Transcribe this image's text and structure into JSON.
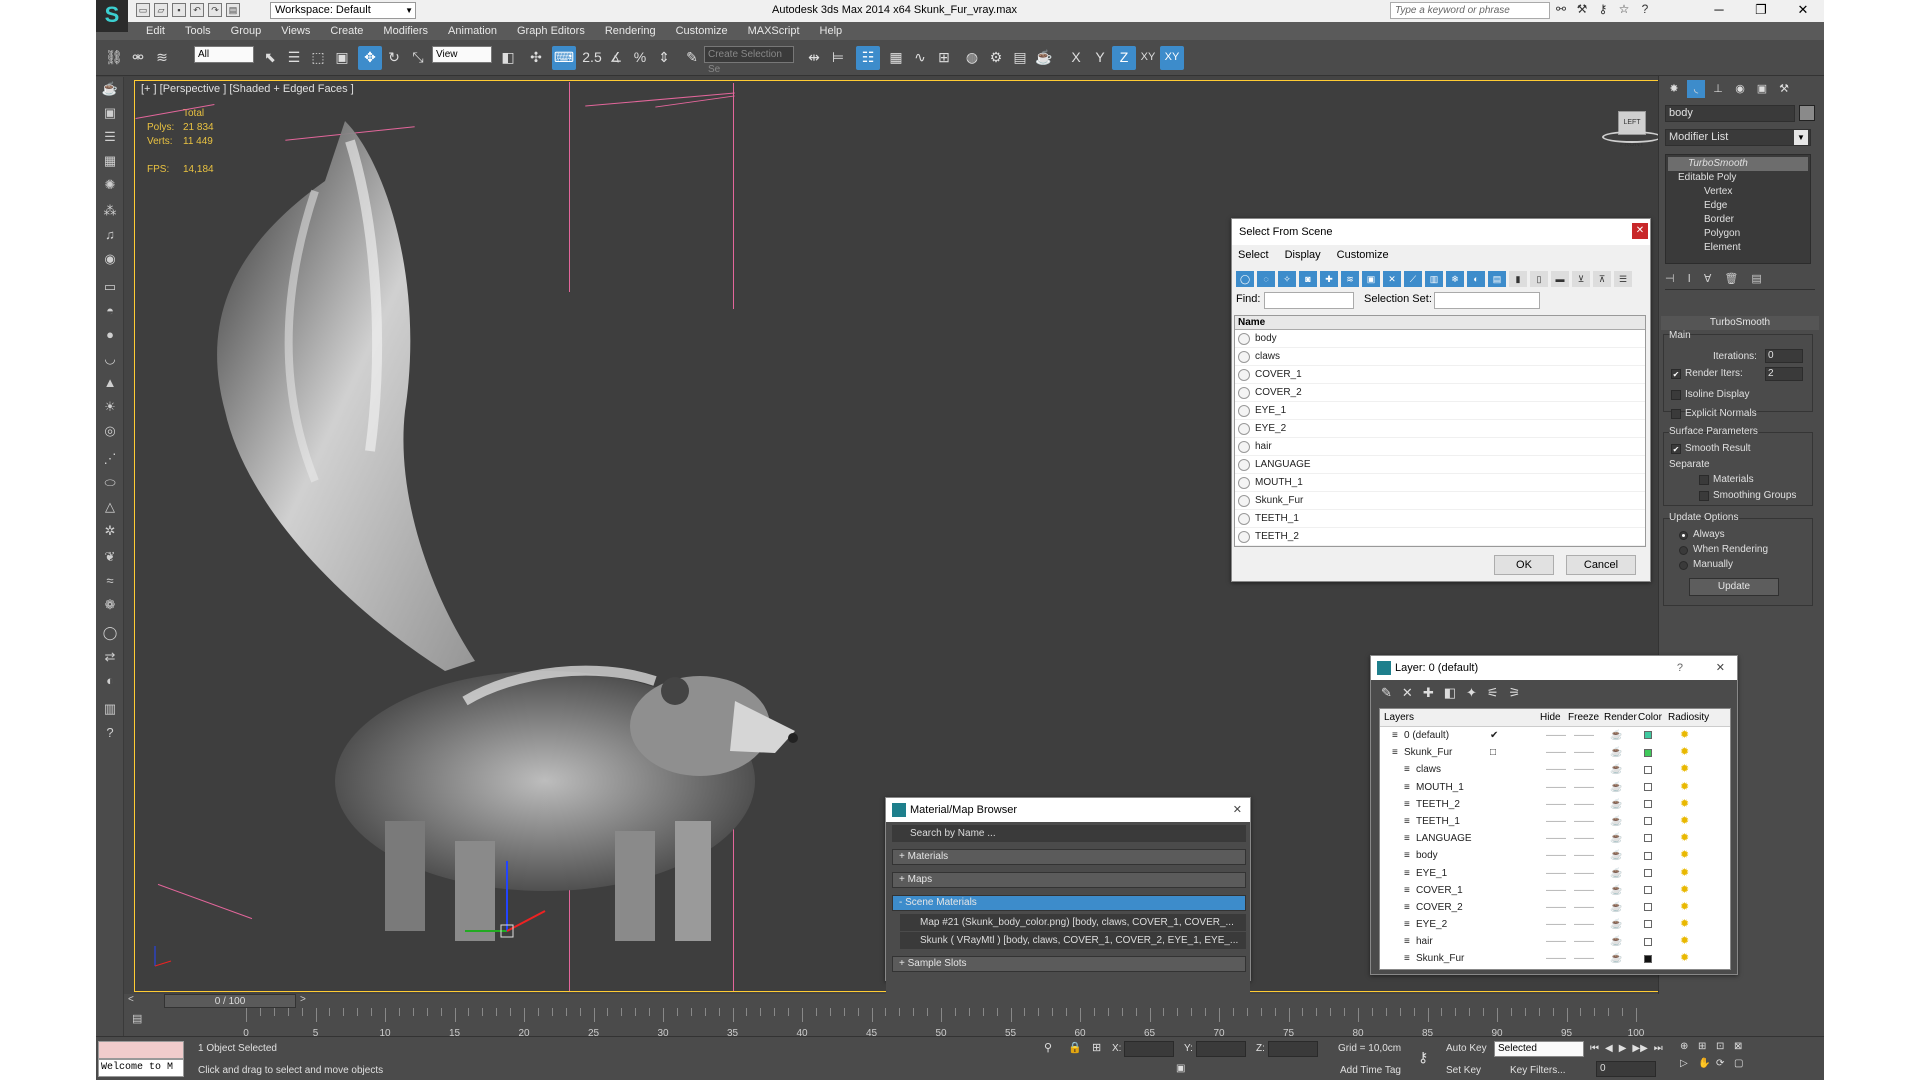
{
  "window": {
    "title": "Autodesk 3ds Max  2014 x64    Skunk_Fur_vray.max",
    "workspace": "Workspace: Default",
    "search_placeholder": "Type a keyword or phrase",
    "logo_glyph": "S"
  },
  "menu": [
    "Edit",
    "Tools",
    "Group",
    "Views",
    "Create",
    "Modifiers",
    "Animation",
    "Graph Editors",
    "Rendering",
    "Customize",
    "MAXScript",
    "Help"
  ],
  "toolbar": {
    "selection_filter": "All",
    "ref_coord": "View",
    "spinner_snap": "2.5",
    "named_selection": "Create Selection Se",
    "axis_labels": [
      "X",
      "Y",
      "Z",
      "XY",
      "XY"
    ]
  },
  "viewport": {
    "label": "[+ ] [Perspective ] [Shaded + Edged Faces ]",
    "stats": {
      "total_label": "Total",
      "polys_label": "Polys:",
      "polys_value": "21 834",
      "verts_label": "Verts:",
      "verts_value": "11 449",
      "fps_label": "FPS:",
      "fps_value": "14,184"
    },
    "viewcube_label": "LEFT FRONT"
  },
  "command_panel": {
    "object_name": "body",
    "modifier_list": "Modifier List",
    "stack": [
      "TurboSmooth",
      "Editable Poly",
      "Vertex",
      "Edge",
      "Border",
      "Polygon",
      "Element"
    ],
    "rollout_title": "TurboSmooth",
    "main_label": "Main",
    "iterations_label": "Iterations:",
    "iterations_value": "0",
    "render_iters_label": "Render Iters:",
    "render_iters_value": "2",
    "render_iters_checked": true,
    "isoline_label": "Isoline Display",
    "explicit_normals_label": "Explicit Normals",
    "surface_params_label": "Surface Parameters",
    "smooth_result_label": "Smooth Result",
    "smooth_result_checked": true,
    "separate_label": "Separate",
    "materials_label": "Materials",
    "smoothing_groups_label": "Smoothing Groups",
    "update_options_label": "Update Options",
    "always_label": "Always",
    "when_rendering_label": "When Rendering",
    "manually_label": "Manually",
    "update_button": "Update"
  },
  "select_from_scene": {
    "title": "Select From Scene",
    "menu": [
      "Select",
      "Display",
      "Customize"
    ],
    "find_label": "Find:",
    "selection_set_label": "Selection Set:",
    "column_name": "Name",
    "items": [
      "body",
      "claws",
      "COVER_1",
      "COVER_2",
      "EYE_1",
      "EYE_2",
      "hair",
      "LANGUAGE",
      "MOUTH_1",
      "Skunk_Fur",
      "TEETH_1",
      "TEETH_2"
    ],
    "ok": "OK",
    "cancel": "Cancel"
  },
  "layer_dialog": {
    "title": "Layer: 0 (default)",
    "help": "?",
    "columns": [
      "Layers",
      "Hide",
      "Freeze",
      "Render",
      "Color",
      "Radiosity"
    ],
    "rows": [
      {
        "name": "0 (default)",
        "indent": 0,
        "color": "#3fc9a0",
        "current": true
      },
      {
        "name": "Skunk_Fur",
        "indent": 0,
        "color": "#3fc95a",
        "current": false
      },
      {
        "name": "claws",
        "indent": 1,
        "color": "#ffffff"
      },
      {
        "name": "MOUTH_1",
        "indent": 1,
        "color": "#ffffff"
      },
      {
        "name": "TEETH_2",
        "indent": 1,
        "color": "#ffffff"
      },
      {
        "name": "TEETH_1",
        "indent": 1,
        "color": "#ffffff"
      },
      {
        "name": "LANGUAGE",
        "indent": 1,
        "color": "#ffffff"
      },
      {
        "name": "body",
        "indent": 1,
        "color": "#ffffff"
      },
      {
        "name": "EYE_1",
        "indent": 1,
        "color": "#ffffff"
      },
      {
        "name": "COVER_1",
        "indent": 1,
        "color": "#ffffff"
      },
      {
        "name": "COVER_2",
        "indent": 1,
        "color": "#ffffff"
      },
      {
        "name": "EYE_2",
        "indent": 1,
        "color": "#ffffff"
      },
      {
        "name": "hair",
        "indent": 1,
        "color": "#ffffff"
      },
      {
        "name": "Skunk_Fur",
        "indent": 1,
        "color": "#111111"
      }
    ]
  },
  "material_browser": {
    "title": "Material/Map Browser",
    "search_placeholder": "Search by Name ...",
    "sections": [
      "+ Materials",
      "+ Maps",
      "- Scene Materials",
      "+ Sample Slots"
    ],
    "items": [
      "Map #21 (Skunk_body_color.png) [body, claws, COVER_1, COVER_...",
      "Skunk  ( VRayMtl )  [body, claws, COVER_1, COVER_2, EYE_1, EYE_..."
    ]
  },
  "timeline": {
    "slider": "0 / 100",
    "ticks": [
      "0",
      "5",
      "10",
      "15",
      "20",
      "25",
      "30",
      "35",
      "40",
      "45",
      "50",
      "55",
      "60",
      "65",
      "70",
      "75",
      "80",
      "85",
      "90",
      "95",
      "100"
    ]
  },
  "status": {
    "maxscript": "Welcome to M",
    "selected": "1 Object Selected",
    "prompt": "Click and drag to select and move objects",
    "x_label": "X:",
    "y_label": "Y:",
    "z_label": "Z:",
    "grid": "Grid = 10,0cm",
    "add_time_tag": "Add Time Tag",
    "auto_key": "Auto Key",
    "set_key": "Set Key",
    "selected_dropdown": "Selected",
    "key_filters": "Key Filters...",
    "frame": "0"
  }
}
